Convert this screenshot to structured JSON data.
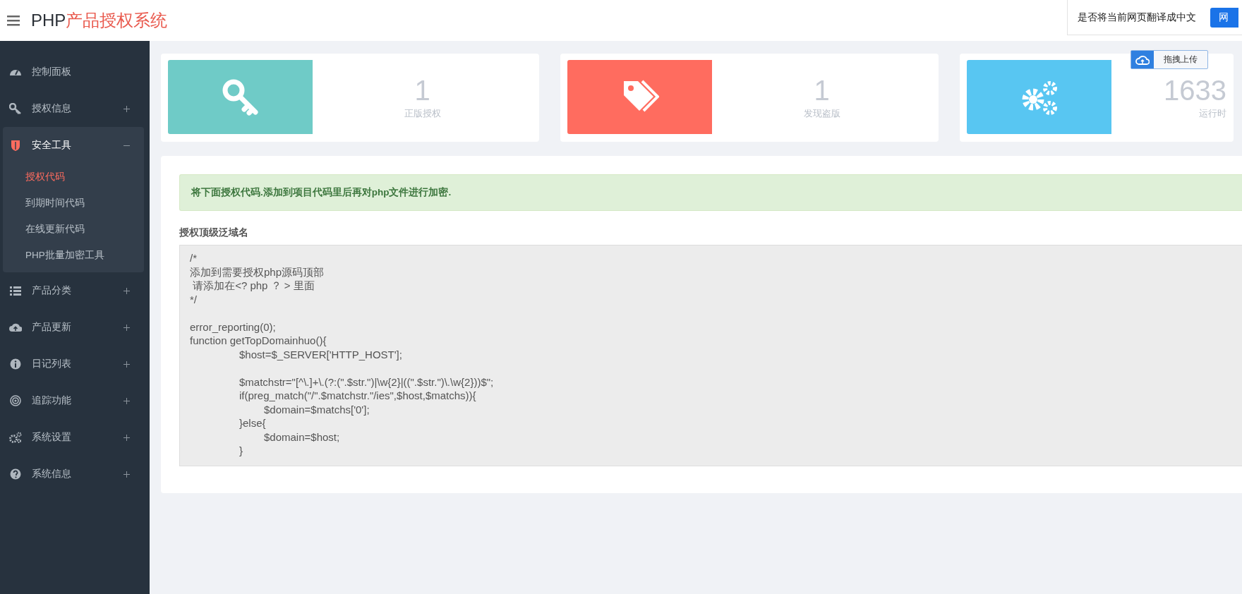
{
  "header": {
    "title_main": "PHP",
    "title_accent": "产品授权系统"
  },
  "translate_prompt": {
    "text": "是否将当前网页翻译成中文",
    "button": "网"
  },
  "upload_button": {
    "label": "拖拽上传"
  },
  "sidebar": {
    "items": [
      {
        "label": "控制面板",
        "expanded": false
      },
      {
        "label": "授权信息",
        "expanded": false
      },
      {
        "label": "安全工具",
        "expanded": true,
        "children": [
          {
            "label": "授权代码",
            "selected": true
          },
          {
            "label": "到期时间代码",
            "selected": false
          },
          {
            "label": "在线更新代码",
            "selected": false
          },
          {
            "label": "PHP批量加密工具",
            "selected": false
          }
        ]
      },
      {
        "label": "产品分类",
        "expanded": false
      },
      {
        "label": "产品更新",
        "expanded": false
      },
      {
        "label": "日记列表",
        "expanded": false
      },
      {
        "label": "追踪功能",
        "expanded": false
      },
      {
        "label": "系统设置",
        "expanded": false
      },
      {
        "label": "系统信息",
        "expanded": false
      }
    ]
  },
  "stats": [
    {
      "value": "1",
      "label": "正版授权",
      "color": "#6fcbc7"
    },
    {
      "value": "1",
      "label": "发现盗版",
      "color": "#ff6c5f"
    },
    {
      "value": "1633",
      "label": "运行时",
      "color": "#58c6f2"
    }
  ],
  "alert": "将下面授权代码.添加到项目代码里后再对php文件进行加密.",
  "code_label": "授权顶级泛域名",
  "code_lines": [
    "/*",
    "添加到需要授权php源码顶部",
    " 请添加在<? php ？ > 里面",
    "*/",
    {
      "text": "error_reporting(0);",
      "blank_before": true
    },
    "function getTopDomainhuo(){",
    "\t\t$host=$_SERVER['HTTP_HOST'];",
    {
      "blank_before": true,
      "text": "\t\t$matchstr=\"[^\\.]+\\.(?:(\".$str.\")|\\w{2}|((\".$str.\")\\.\\w{2}))$\";"
    },
    "\t\tif(preg_match(\"/\".$matchstr.\"/ies\",$host,$matchs)){",
    "\t\t\t$domain=$matchs['0'];",
    "\t\t}else{",
    "\t\t\t$domain=$host;",
    "\t\t}"
  ]
}
